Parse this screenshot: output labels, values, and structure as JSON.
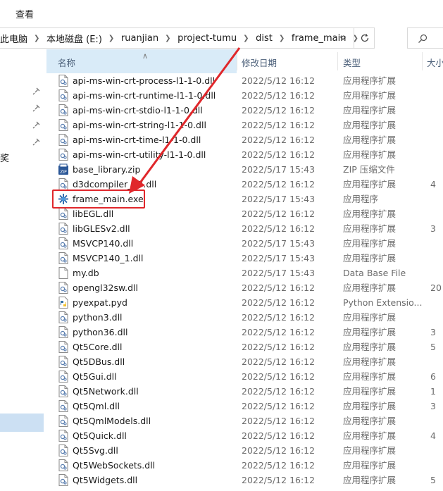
{
  "menubar": {
    "view_label": "查看"
  },
  "address": {
    "crumbs": [
      "此电脑",
      "本地磁盘 (E:)",
      "ruanjian",
      "project-tumu",
      "dist",
      "frame_main"
    ],
    "dropdown_icon": "chevron-down-icon",
    "refresh_icon": "refresh-icon"
  },
  "search": {
    "icon": "search-icon"
  },
  "nav": {
    "label": "奖"
  },
  "columns": {
    "name": "名称",
    "date": "修改日期",
    "type": "类型",
    "size": "大小"
  },
  "accent_color": "#e0272b",
  "files": [
    {
      "name": "api-ms-win-crt-process-l1-1-0.dll",
      "date": "2022/5/12 16:12",
      "type": "应用程序扩展",
      "size": "",
      "icon": "dll-icon"
    },
    {
      "name": "api-ms-win-crt-runtime-l1-1-0.dll",
      "date": "2022/5/12 16:12",
      "type": "应用程序扩展",
      "size": "",
      "icon": "dll-icon"
    },
    {
      "name": "api-ms-win-crt-stdio-l1-1-0.dll",
      "date": "2022/5/12 16:12",
      "type": "应用程序扩展",
      "size": "",
      "icon": "dll-icon"
    },
    {
      "name": "api-ms-win-crt-string-l1-1-0.dll",
      "date": "2022/5/12 16:12",
      "type": "应用程序扩展",
      "size": "",
      "icon": "dll-icon"
    },
    {
      "name": "api-ms-win-crt-time-l1-1-0.dll",
      "date": "2022/5/12 16:12",
      "type": "应用程序扩展",
      "size": "",
      "icon": "dll-icon"
    },
    {
      "name": "api-ms-win-crt-utility-l1-1-0.dll",
      "date": "2022/5/12 16:12",
      "type": "应用程序扩展",
      "size": "",
      "icon": "dll-icon"
    },
    {
      "name": "base_library.zip",
      "date": "2022/5/17 15:43",
      "type": "ZIP 压缩文件",
      "size": "",
      "icon": "zip-icon"
    },
    {
      "name": "d3dcompiler_47.dll",
      "date": "2022/5/12 16:12",
      "type": "应用程序扩展",
      "size": "4",
      "icon": "dll-icon"
    },
    {
      "name": "frame_main.exe",
      "date": "2022/5/17 15:43",
      "type": "应用程序",
      "size": "",
      "icon": "exe-icon"
    },
    {
      "name": "libEGL.dll",
      "date": "2022/5/12 16:12",
      "type": "应用程序扩展",
      "size": "",
      "icon": "dll-icon"
    },
    {
      "name": "libGLESv2.dll",
      "date": "2022/5/12 16:12",
      "type": "应用程序扩展",
      "size": "3",
      "icon": "dll-icon"
    },
    {
      "name": "MSVCP140.dll",
      "date": "2022/5/17 15:43",
      "type": "应用程序扩展",
      "size": "",
      "icon": "dll-icon"
    },
    {
      "name": "MSVCP140_1.dll",
      "date": "2022/5/17 15:43",
      "type": "应用程序扩展",
      "size": "",
      "icon": "dll-icon"
    },
    {
      "name": "my.db",
      "date": "2022/5/17 15:43",
      "type": "Data Base File",
      "size": "",
      "icon": "file-icon"
    },
    {
      "name": "opengl32sw.dll",
      "date": "2022/5/12 16:12",
      "type": "应用程序扩展",
      "size": "20",
      "icon": "dll-icon"
    },
    {
      "name": "pyexpat.pyd",
      "date": "2022/5/12 16:12",
      "type": "Python Extensio...",
      "size": "",
      "icon": "pyd-icon"
    },
    {
      "name": "python3.dll",
      "date": "2022/5/12 16:12",
      "type": "应用程序扩展",
      "size": "",
      "icon": "dll-icon"
    },
    {
      "name": "python36.dll",
      "date": "2022/5/12 16:12",
      "type": "应用程序扩展",
      "size": "3",
      "icon": "dll-icon"
    },
    {
      "name": "Qt5Core.dll",
      "date": "2022/5/12 16:12",
      "type": "应用程序扩展",
      "size": "5",
      "icon": "dll-icon"
    },
    {
      "name": "Qt5DBus.dll",
      "date": "2022/5/12 16:12",
      "type": "应用程序扩展",
      "size": "",
      "icon": "dll-icon"
    },
    {
      "name": "Qt5Gui.dll",
      "date": "2022/5/12 16:12",
      "type": "应用程序扩展",
      "size": "6",
      "icon": "dll-icon"
    },
    {
      "name": "Qt5Network.dll",
      "date": "2022/5/12 16:12",
      "type": "应用程序扩展",
      "size": "1",
      "icon": "dll-icon"
    },
    {
      "name": "Qt5Qml.dll",
      "date": "2022/5/12 16:12",
      "type": "应用程序扩展",
      "size": "3",
      "icon": "dll-icon"
    },
    {
      "name": "Qt5QmlModels.dll",
      "date": "2022/5/12 16:12",
      "type": "应用程序扩展",
      "size": "",
      "icon": "dll-icon"
    },
    {
      "name": "Qt5Quick.dll",
      "date": "2022/5/12 16:12",
      "type": "应用程序扩展",
      "size": "4",
      "icon": "dll-icon"
    },
    {
      "name": "Qt5Svg.dll",
      "date": "2022/5/12 16:12",
      "type": "应用程序扩展",
      "size": "",
      "icon": "dll-icon"
    },
    {
      "name": "Qt5WebSockets.dll",
      "date": "2022/5/12 16:12",
      "type": "应用程序扩展",
      "size": "",
      "icon": "dll-icon"
    },
    {
      "name": "Qt5Widgets.dll",
      "date": "2022/5/12 16:12",
      "type": "应用程序扩展",
      "size": "5",
      "icon": "dll-icon"
    }
  ]
}
